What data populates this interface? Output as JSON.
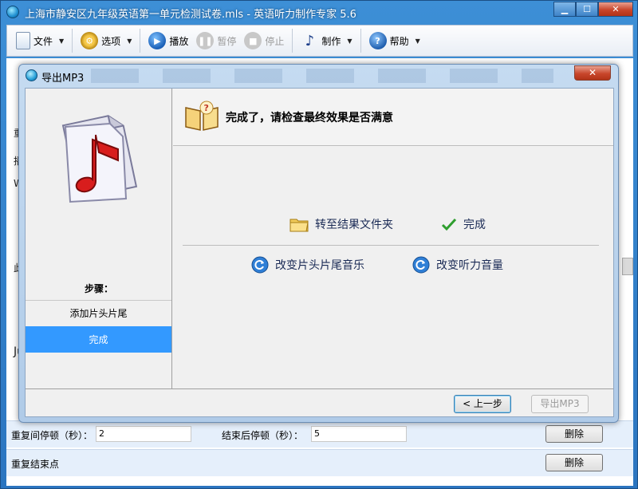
{
  "window": {
    "title": "上海市静安区九年级英语第一单元检测试卷.mls - 英语听力制作专家 5.6",
    "minimize": "▁",
    "maximize": "☐",
    "close": "✕"
  },
  "toolbar": {
    "file": "文件",
    "options": "选项",
    "play": "播放",
    "pause": "暂停",
    "stop": "停止",
    "make": "制作",
    "help": "帮助"
  },
  "background": {
    "stub_1": "重",
    "stub_2": "播",
    "stub_3": "Wh",
    "stub_4": "此",
    "stub_5": "Ju",
    "repeat_pause_label": "重复间停顿（秒）：",
    "repeat_pause_value": "2",
    "end_pause_label": "结束后停顿（秒）：",
    "end_pause_value": "5",
    "delete_1": "删除",
    "repeat_end_label": "重复结束点",
    "delete_2": "删除"
  },
  "dialog": {
    "title": "导出MP3",
    "close": "✕",
    "steps_label": "步骤：",
    "steps": [
      {
        "label": "添加片头片尾"
      },
      {
        "label": "完成"
      }
    ],
    "header": "完成了，请检查最终效果是否满意",
    "goto_folder": "转至结果文件夹",
    "finish": "完成",
    "change_music": "改变片头片尾音乐",
    "change_volume": "改变听力音量",
    "prev_button": "< 上一步",
    "export_button": "导出MP3"
  }
}
